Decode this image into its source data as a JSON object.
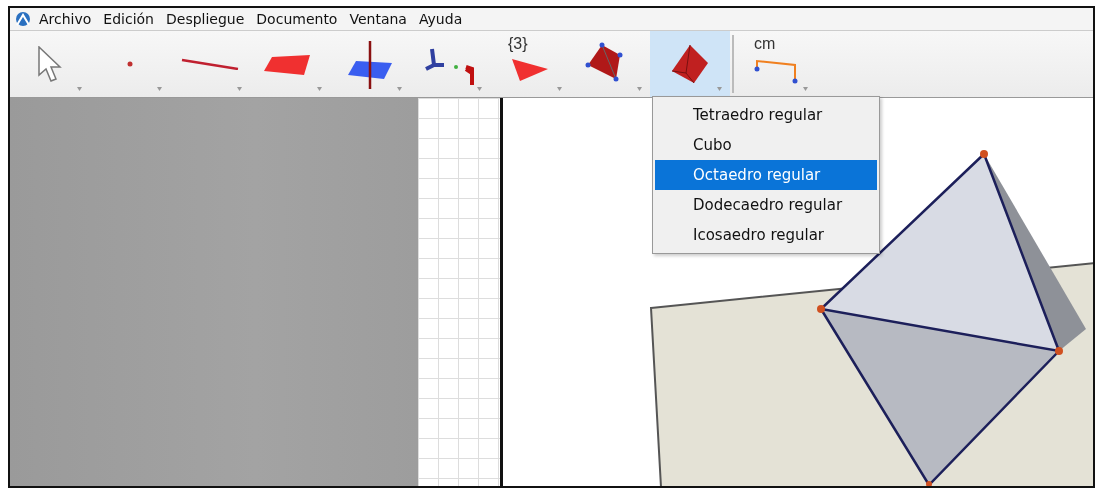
{
  "menu_bar": [
    "Archivo",
    "Edición",
    "Despliegue",
    "Documento",
    "Ventana",
    "Ayuda"
  ],
  "toolbar": {
    "tools": [
      {
        "kind": "pointer",
        "selected": false
      },
      {
        "kind": "point",
        "selected": false
      },
      {
        "kind": "line",
        "selected": false
      },
      {
        "kind": "plane",
        "selected": false
      },
      {
        "kind": "perpendicular",
        "selected": false
      },
      {
        "kind": "axes",
        "selected": false
      },
      {
        "kind": "polygon",
        "label": "{3}",
        "selected": false
      },
      {
        "kind": "pyramid",
        "selected": false
      },
      {
        "kind": "octahedron",
        "selected": true
      },
      {
        "kind": "measure",
        "label": "cm",
        "selected": false
      }
    ]
  },
  "dropdown": {
    "items": [
      {
        "label": "Tetraedro regular",
        "selected": false
      },
      {
        "label": "Cubo",
        "selected": false
      },
      {
        "label": "Octaedro regular",
        "selected": true
      },
      {
        "label": "Dodecaedro regular",
        "selected": false
      },
      {
        "label": "Icosaedro regular",
        "selected": false
      }
    ]
  }
}
